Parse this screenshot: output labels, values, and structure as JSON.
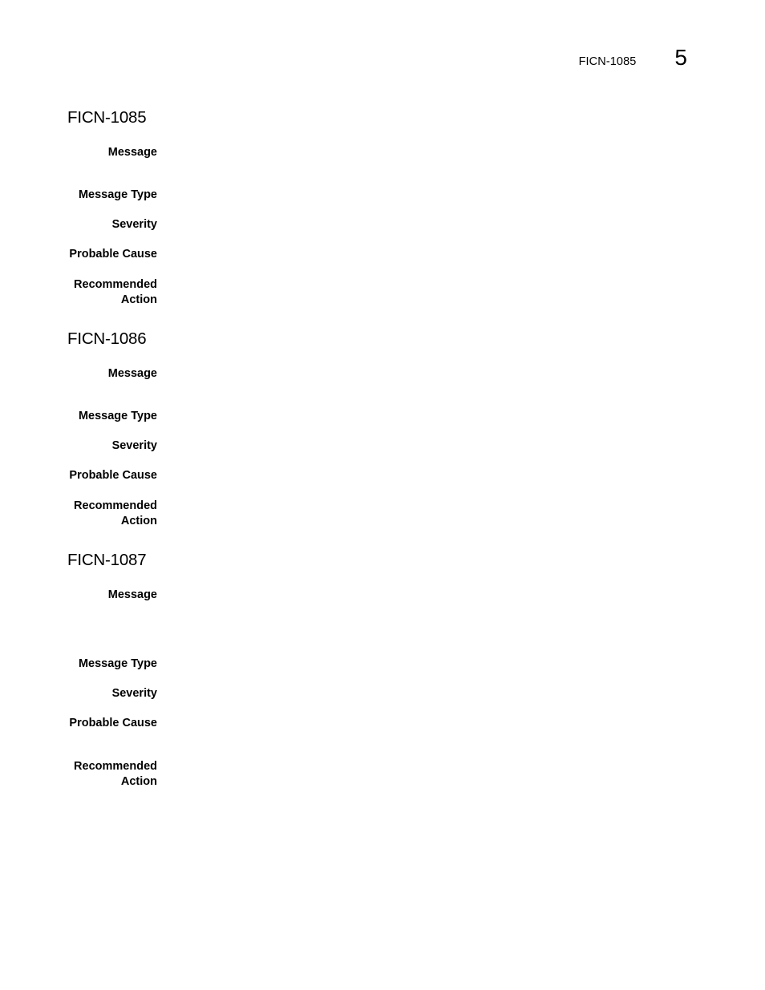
{
  "running_header": {
    "title": "FICN-1085",
    "chapter_number": "5"
  },
  "sections": [
    {
      "heading": "FICN-1085",
      "fields": {
        "message": {
          "label": "Message",
          "value": ""
        },
        "message_type": {
          "label": "Message Type",
          "value": ""
        },
        "severity": {
          "label": "Severity",
          "value": ""
        },
        "probable_cause": {
          "label": "Probable Cause",
          "value": ""
        },
        "recommended_action": {
          "label_line1": "Recommended",
          "label_line2": "Action",
          "value": ""
        }
      }
    },
    {
      "heading": "FICN-1086",
      "fields": {
        "message": {
          "label": "Message",
          "value": ""
        },
        "message_type": {
          "label": "Message Type",
          "value": ""
        },
        "severity": {
          "label": "Severity",
          "value": ""
        },
        "probable_cause": {
          "label": "Probable Cause",
          "value": ""
        },
        "recommended_action": {
          "label_line1": "Recommended",
          "label_line2": "Action",
          "value": ""
        }
      }
    },
    {
      "heading": "FICN-1087",
      "fields": {
        "message": {
          "label": "Message",
          "value": ""
        },
        "message_type": {
          "label": "Message Type",
          "value": ""
        },
        "severity": {
          "label": "Severity",
          "value": ""
        },
        "probable_cause": {
          "label": "Probable Cause",
          "value": ""
        },
        "recommended_action": {
          "label_line1": "Recommended",
          "label_line2": "Action",
          "value": ""
        }
      }
    }
  ]
}
